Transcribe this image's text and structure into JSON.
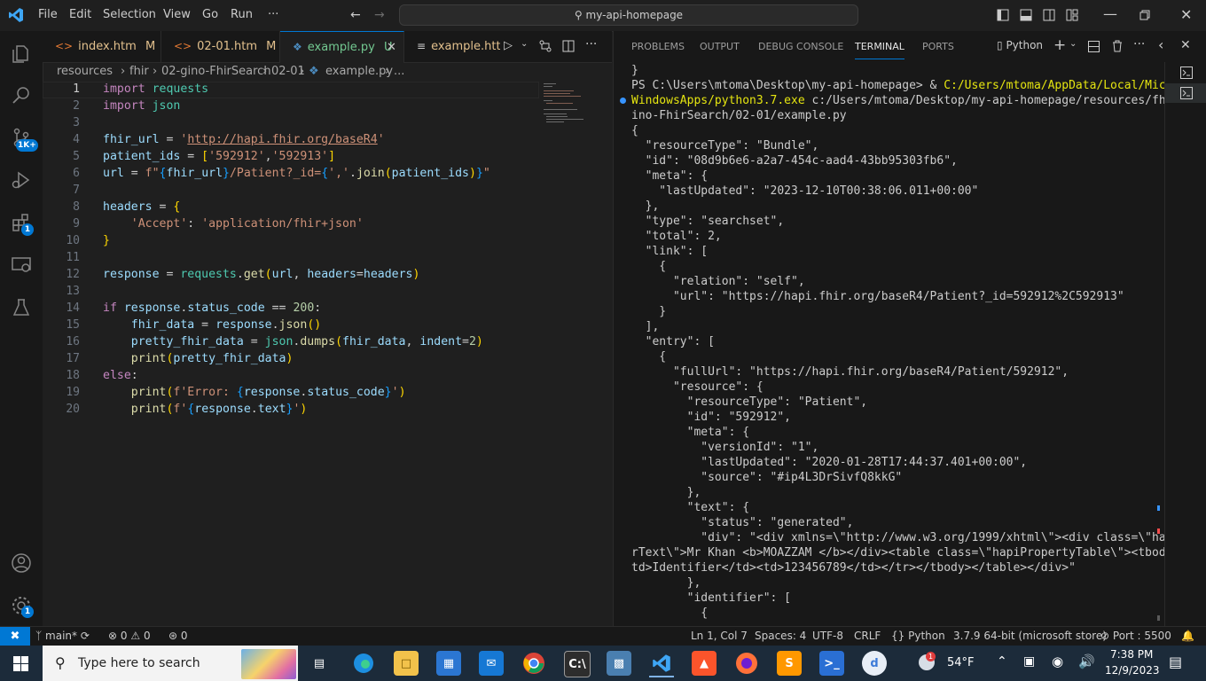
{
  "titlebar": {
    "menus": [
      "File",
      "Edit",
      "Selection",
      "View",
      "Go",
      "Run",
      "···"
    ],
    "command_center": "my-api-homepage"
  },
  "activity": {
    "source_control_badge": "1K+",
    "extensions_badge": "1",
    "settings_badge": "1"
  },
  "tabs": [
    {
      "label": "index.htm",
      "status": "M",
      "icon": "html-icon"
    },
    {
      "label": "02-01.htm",
      "status": "M",
      "icon": "html-icon"
    },
    {
      "label": "example.py",
      "status": "U",
      "icon": "python-icon"
    },
    {
      "label": "example.http",
      "status": "",
      "icon": "http-icon"
    }
  ],
  "breadcrumb": [
    "resources",
    "fhir",
    "02-gino-FhirSearch",
    "02-01",
    "example.py",
    "..."
  ],
  "code_lines": [
    "import requests",
    "import json",
    "",
    "fhir_url = 'http://hapi.fhir.org/baseR4'",
    "patient_ids = ['592912','592913']",
    "url = f\"{fhir_url}/Patient?_id={','.join(patient_ids)}\"",
    "",
    "headers = {",
    "    'Accept': 'application/fhir+json'",
    "}",
    "",
    "response = requests.get(url, headers=headers)",
    "",
    "if response.status_code == 200:",
    "    fhir_data = response.json()",
    "    pretty_fhir_data = json.dumps(fhir_data, indent=2)",
    "    print(pretty_fhir_data)",
    "else:",
    "    print(f'Error: {response.status_code}')",
    "    print(f'{response.text}')"
  ],
  "panel": {
    "tabs": [
      "PROBLEMS",
      "OUTPUT",
      "DEBUG CONSOLE",
      "TERMINAL",
      "PORTS"
    ],
    "active_tab": "TERMINAL",
    "terminal_profile": "Python"
  },
  "terminal_lines": [
    "}",
    "PS C:\\Users\\mtoma\\Desktop\\my-api-homepage> & C:/Users/mtoma/AppData/Local/Microsoft/",
    "WindowsApps/python3.7.exe c:/Users/mtoma/Desktop/my-api-homepage/resources/fhir/02-g",
    "ino-FhirSearch/02-01/example.py",
    "{",
    "  \"resourceType\": \"Bundle\",",
    "  \"id\": \"08d9b6e6-a2a7-454c-aad4-43bb95303fb6\",",
    "  \"meta\": {",
    "    \"lastUpdated\": \"2023-12-10T00:38:06.011+00:00\"",
    "  },",
    "  \"type\": \"searchset\",",
    "  \"total\": 2,",
    "  \"link\": [",
    "    {",
    "      \"relation\": \"self\",",
    "      \"url\": \"https://hapi.fhir.org/baseR4/Patient?_id=592912%2C592913\"",
    "    }",
    "  ],",
    "  \"entry\": [",
    "    {",
    "      \"fullUrl\": \"https://hapi.fhir.org/baseR4/Patient/592912\",",
    "      \"resource\": {",
    "        \"resourceType\": \"Patient\",",
    "        \"id\": \"592912\",",
    "        \"meta\": {",
    "          \"versionId\": \"1\",",
    "          \"lastUpdated\": \"2020-01-28T17:44:37.401+00:00\",",
    "          \"source\": \"#ip4L3DrSivfQ8kkG\"",
    "        },",
    "        \"text\": {",
    "          \"status\": \"generated\",",
    "          \"div\": \"<div xmlns=\\\"http://www.w3.org/1999/xhtml\\\"><div class=\\\"hapiHeade",
    "rText\\\">Mr Khan <b>MOAZZAM </b></div><table class=\\\"hapiPropertyTable\\\"><tbody><tr><",
    "td>Identifier</td><td>123456789</td></tr></tbody></table></div>\"",
    "        },",
    "        \"identifier\": [",
    "          {"
  ],
  "status": {
    "branch": "main*",
    "errors": "0",
    "warnings": "0",
    "ports_forward": "0",
    "position": "Ln 1, Col 7",
    "spaces": "Spaces: 4",
    "encoding": "UTF-8",
    "eol": "CRLF",
    "language": "Python",
    "interpreter": "3.7.9 64-bit (microsoft store)",
    "port": "Port : 5500"
  },
  "taskbar": {
    "search_placeholder": "Type here to search",
    "weather": "54°F",
    "time": "7:38 PM",
    "date": "12/9/2023"
  },
  "colors": {
    "accent": "#0078d4",
    "editor_bg": "#1f1f1f",
    "panel_bg": "#181818",
    "taskbar_bg": "#1c2b3a"
  }
}
